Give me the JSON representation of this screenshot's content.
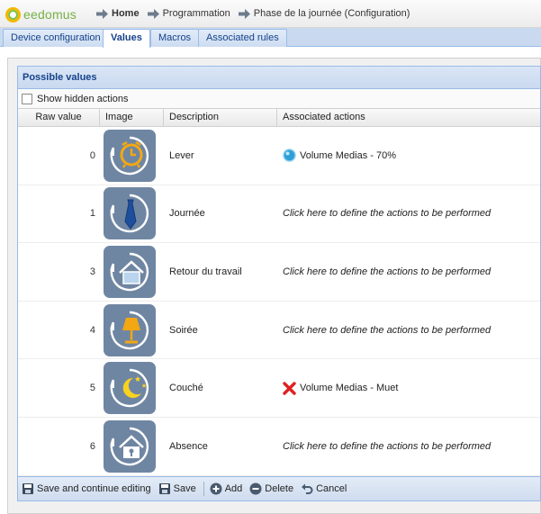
{
  "app": {
    "logo_text": "eedomus"
  },
  "breadcrumb": [
    {
      "label": "Home",
      "current": true
    },
    {
      "label": "Programmation",
      "current": false
    },
    {
      "label": "Phase de la journée (Configuration)",
      "current": false
    }
  ],
  "tabs": [
    {
      "label": "Device configuration",
      "active": false
    },
    {
      "label": "Values",
      "active": true
    },
    {
      "label": "Macros",
      "active": false
    },
    {
      "label": "Associated rules",
      "active": false
    }
  ],
  "panel": {
    "title": "Possible values",
    "show_hidden_label": "Show hidden actions",
    "show_hidden_checked": false
  },
  "columns": {
    "raw": "Raw value",
    "image": "Image",
    "description": "Description",
    "actions": "Associated actions"
  },
  "rows": [
    {
      "raw": "0",
      "icon": "alarm-clock-icon",
      "description": "Lever",
      "action": "Volume Medias - 70%",
      "action_icon": "blue-bubble-icon",
      "action_defined": true
    },
    {
      "raw": "1",
      "icon": "necktie-icon",
      "description": "Journée",
      "action": "Click here to define the actions to be performed",
      "action_icon": "",
      "action_defined": false
    },
    {
      "raw": "3",
      "icon": "house-icon",
      "description": "Retour du travail",
      "action": "Click here to define the actions to be performed",
      "action_icon": "",
      "action_defined": false
    },
    {
      "raw": "4",
      "icon": "lamp-icon",
      "description": "Soirée",
      "action": "Click here to define the actions to be performed",
      "action_icon": "",
      "action_defined": false
    },
    {
      "raw": "5",
      "icon": "moon-stars-icon",
      "description": "Couché",
      "action": "Volume Medias - Muet",
      "action_icon": "red-cross-icon",
      "action_defined": true
    },
    {
      "raw": "6",
      "icon": "house-lock-icon",
      "description": "Absence",
      "action": "Click here to define the actions to be performed",
      "action_icon": "",
      "action_defined": false
    }
  ],
  "toolbar": {
    "save_continue": "Save and continue editing",
    "save": "Save",
    "add": "Add",
    "delete": "Delete",
    "cancel": "Cancel"
  },
  "colors": {
    "accent": "#15428b",
    "tile": "#6f86a3",
    "tab_strip": "#c9daf0",
    "logo_green": "#76b043"
  }
}
